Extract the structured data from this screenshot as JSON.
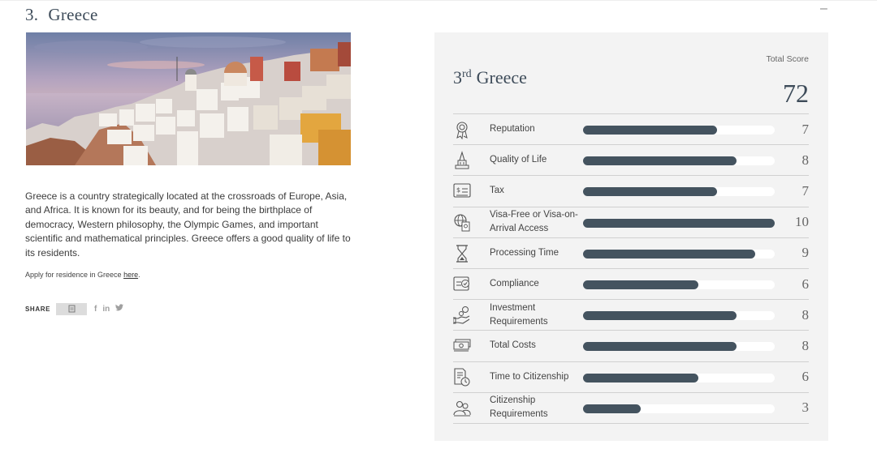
{
  "section": {
    "number": "3.",
    "title": "Greece",
    "collapse_symbol": "–"
  },
  "description": "Greece is a country strategically located at the crossroads of Europe, Asia, and Africa. It is known for its beauty, and for being the birthplace of democracy, Western philosophy, the Olympic Games, and important scientific and mathematical principles. Greece offers a good quality of life to its residents.",
  "apply": {
    "prefix": "Apply for residence in Greece ",
    "link": "here",
    "suffix": "."
  },
  "share": {
    "label": "SHARE",
    "icons": [
      "copy-icon",
      "facebook-icon",
      "linkedin-icon",
      "twitter-icon"
    ],
    "facebook": "f",
    "linkedin": "in",
    "twitter": "🐦"
  },
  "card": {
    "rank_num": "3",
    "rank_suffix": "rd",
    "country": "Greece",
    "total_label": "Total Score",
    "total_score": "72",
    "max_score": 10,
    "bar_color": "#44535f",
    "rows": [
      {
        "label": "Reputation",
        "score": "7",
        "icon": "award-icon"
      },
      {
        "label": "Quality of Life",
        "score": "8",
        "icon": "monument-icon"
      },
      {
        "label": "Tax",
        "score": "7",
        "icon": "tax-document-icon"
      },
      {
        "label": "Visa-Free or Visa-on-Arrival Access",
        "score": "10",
        "icon": "globe-passport-icon"
      },
      {
        "label": "Processing Time",
        "score": "9",
        "icon": "hourglass-icon"
      },
      {
        "label": "Compliance",
        "score": "6",
        "icon": "compliance-check-icon"
      },
      {
        "label": "Investment Requirements",
        "score": "8",
        "icon": "investment-hand-icon"
      },
      {
        "label": "Total Costs",
        "score": "8",
        "icon": "money-stack-icon"
      },
      {
        "label": "Time to Citizenship",
        "score": "6",
        "icon": "document-clock-icon"
      },
      {
        "label": "Citizenship Requirements",
        "score": "3",
        "icon": "people-group-icon"
      }
    ]
  }
}
